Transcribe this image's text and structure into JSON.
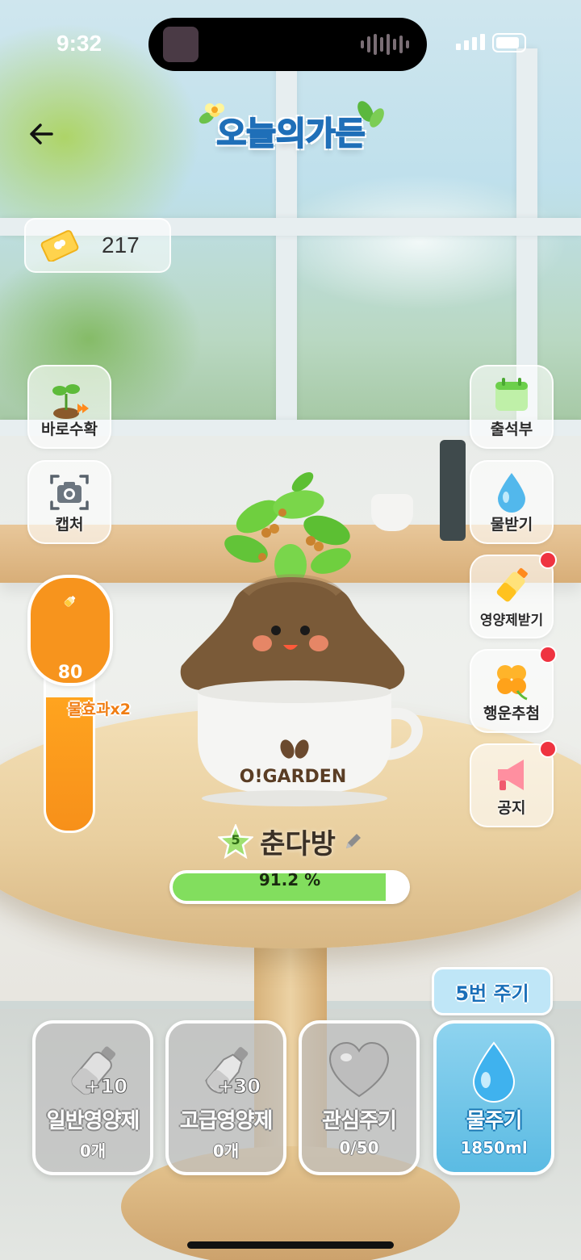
{
  "status_bar": {
    "time": "9:32"
  },
  "header": {
    "logo_text": "오늘의가든"
  },
  "coins": {
    "count": "217"
  },
  "left_buttons": [
    {
      "label": "바로수확",
      "icon": "sprout-arrow-icon"
    },
    {
      "label": "캡처",
      "icon": "camera-icon"
    }
  ],
  "right_buttons": [
    {
      "label": "출석부",
      "icon": "calendar-icon",
      "badge": false
    },
    {
      "label": "물받기",
      "icon": "water-drop-icon",
      "badge": false
    },
    {
      "label": "영양제받기",
      "icon": "nutrient-bottle-icon",
      "badge": true
    },
    {
      "label": "행운추첨",
      "icon": "clover-icon",
      "badge": true
    },
    {
      "label": "공지",
      "icon": "megaphone-icon",
      "badge": true
    }
  ],
  "gauge": {
    "value": "80",
    "effect_label": "물효과x2",
    "fill_percent": 62
  },
  "plant": {
    "level": "5",
    "name": "춘다방",
    "progress_text": "91.2 %",
    "progress_percent": 91.2,
    "pot_label": "O!GARDEN"
  },
  "cycle_badge": "5번 주기",
  "actions": [
    {
      "title": "일반영양제",
      "sub": "0개",
      "plus": "+10",
      "icon": "nutrient-bottle-icon"
    },
    {
      "title": "고급영양제",
      "sub": "0개",
      "plus": "+30",
      "icon": "premium-bottle-icon"
    },
    {
      "title": "관심주기",
      "sub": "0/50",
      "icon": "heart-icon"
    },
    {
      "title": "물주기",
      "sub": "1850ml",
      "icon": "water-drop-icon"
    }
  ],
  "colors": {
    "accent_orange": "#f7941d",
    "progress_green": "#82de5e",
    "water_blue": "#5bbbe3",
    "badge_red": "#ef3340"
  }
}
